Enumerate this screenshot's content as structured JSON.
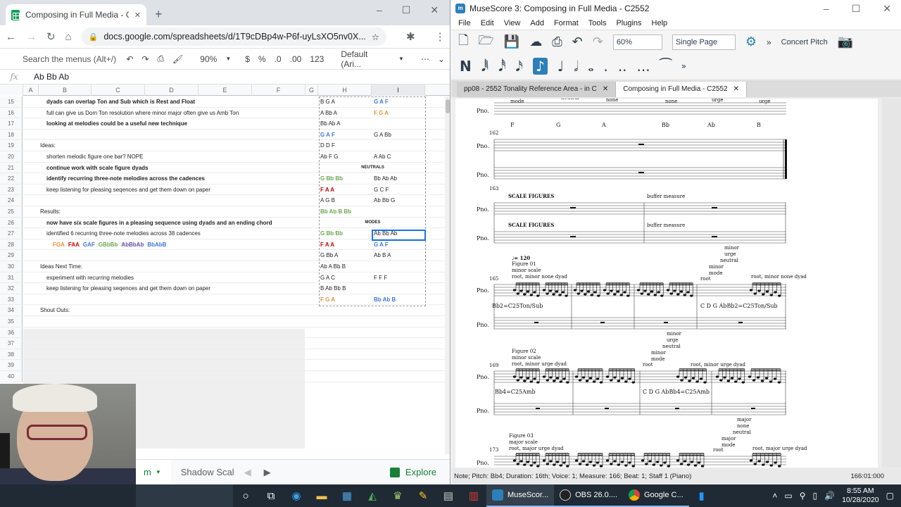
{
  "chrome": {
    "tab_title": "Composing in Full Media - Goog",
    "url": "docs.google.com/spreadsheets/d/1T9cDBp4w-P6f-uyLsXO5nv0X...",
    "new_tab": "+",
    "minimize": "–",
    "maximize": "☐",
    "close": "✕"
  },
  "sheets": {
    "search_menus": "Search the menus (Alt+/)",
    "zoom": "90%",
    "currency": "$",
    "percent": "%",
    "dec_less": ".0",
    "dec_more": ".00",
    "number_format": "123",
    "font": "Default (Ari...",
    "more": "⋯",
    "fx": "fx",
    "formula_value": "Ab Bb Ab",
    "columns": [
      "A",
      "B",
      "C",
      "D",
      "E",
      "F",
      "G",
      "H",
      "I"
    ],
    "rows": [
      {
        "n": "15",
        "b": "dyads can overlap Ton and Sub which is Rest and Float",
        "b_style": "bold indent1",
        "h": "B G A",
        "h_color": "#222",
        "i": "G A F",
        "i_color": "#3c78d8"
      },
      {
        "n": "16",
        "b": "full can give us Dom Ton resolution where minor major often give us Amb Ton",
        "b_style": "indent1",
        "h": "A Bb A",
        "h_color": "#222",
        "i": "F G A",
        "i_color": "#e69138"
      },
      {
        "n": "17",
        "b": "looking at melodies could be a useful new technique",
        "b_style": "bold indent1",
        "h": "Bb Ab A",
        "h_color": "#222",
        "i": "",
        "i_color": "#222"
      },
      {
        "n": "18",
        "b": "",
        "b_style": "",
        "h": "G A F",
        "h_color": "#3c78d8",
        "i": "G A Bb",
        "i_color": "#222"
      },
      {
        "n": "19",
        "b": "Ideas:",
        "b_style": "",
        "h": "D D F",
        "h_color": "#222",
        "i": "",
        "i_color": "#222"
      },
      {
        "n": "20",
        "b": "shorten melodic figure one bar? NOPE",
        "b_style": "indent1",
        "h": "Ab F G",
        "h_color": "#222",
        "i": "A Ab C",
        "i_color": "#222"
      },
      {
        "n": "21",
        "b": "continue work with scale figure dyads",
        "b_style": "bold indent1",
        "hi": "NEUTRALS"
      },
      {
        "n": "22",
        "b": "identify recurring three-note melodies across the cadences",
        "b_style": "bold indent1",
        "h": "G Bb Bb",
        "h_color": "#6aa84f",
        "i": "Bb Ab Ab",
        "i_color": "#222"
      },
      {
        "n": "23",
        "b": "keep listening for pleasing seqences and get them down on paper",
        "b_style": "indent1",
        "h": "F A A",
        "h_color": "#cc0000",
        "i": "G C F",
        "i_color": "#222"
      },
      {
        "n": "24",
        "b": "",
        "b_style": "",
        "h": "A G B",
        "h_color": "#222",
        "i": "Ab Bb G",
        "i_color": "#222"
      },
      {
        "n": "25",
        "b": "Results:",
        "b_style": "",
        "h": "Bb Ab B Bb",
        "h_color": "#6aa84f",
        "i": "",
        "i_color": "#222"
      },
      {
        "n": "26",
        "b": "now have six scale figures in a pleasing sequence using dyads and an ending chord",
        "b_style": "bold indent1",
        "hi": "MODES"
      },
      {
        "n": "27",
        "b": "identified 6 recurring three-note melodies across 38 cadences",
        "b_style": "indent1",
        "h": "G Bb Bb",
        "h_color": "#6aa84f",
        "i": "Ab Bb Ab",
        "i_color": "#222"
      },
      {
        "n": "28",
        "b": "",
        "b_style": "",
        "h": "F A A",
        "h_color": "#cc0000",
        "i": "G A F",
        "i_color": "#3c78d8",
        "melodies": true
      },
      {
        "n": "29",
        "b": "",
        "b_style": "",
        "h": "G Bb A",
        "h_color": "#222",
        "i": "Ab B A",
        "i_color": "#222"
      },
      {
        "n": "30",
        "b": "Ideas Next Time:",
        "b_style": "",
        "h": "Ab A Bb B",
        "h_color": "#222",
        "i": "",
        "i_color": "#222"
      },
      {
        "n": "31",
        "b": "experiment with recurring melodies",
        "b_style": "indent1",
        "h": "G A C",
        "h_color": "#222",
        "i": "F F F",
        "i_color": "#222"
      },
      {
        "n": "32",
        "b": "keep listening for pleasing seqences and get them down on paper",
        "b_style": "indent1",
        "h": "B Ab Bb B",
        "h_color": "#222",
        "i": "",
        "i_color": "#222"
      },
      {
        "n": "33",
        "b": "",
        "b_style": "",
        "h": "F G A",
        "h_color": "#e69138",
        "i": "Bb Ab B",
        "i_color": "#3c78d8"
      },
      {
        "n": "34",
        "b": "Shout Outs:",
        "b_style": "",
        "h": "",
        "h_color": "#222",
        "i": "",
        "i_color": "#222"
      },
      {
        "n": "35",
        "b": ""
      },
      {
        "n": "36",
        "b": ""
      },
      {
        "n": "37",
        "b": ""
      },
      {
        "n": "38",
        "b": ""
      },
      {
        "n": "39",
        "b": ""
      },
      {
        "n": "40",
        "b": ""
      }
    ],
    "melodies_row": [
      {
        "t": "FGA",
        "c": "#e69138"
      },
      {
        "t": "FAA",
        "c": "#cc0000"
      },
      {
        "t": "GAF",
        "c": "#3c78d8"
      },
      {
        "t": "GBbBb",
        "c": "#6aa84f"
      },
      {
        "t": "AbBbAb",
        "c": "#674ea7"
      },
      {
        "t": "BbAbB",
        "c": "#3c78d8"
      }
    ],
    "sheet_tab_partial": "m",
    "sheet_tab_shadow": "Shadow Scal",
    "explore": "Explore"
  },
  "musescore": {
    "title": "MuseScore 3: Composing in Full Media - C2552",
    "menu": [
      "File",
      "Edit",
      "View",
      "Add",
      "Format",
      "Tools",
      "Plugins",
      "Help"
    ],
    "zoom": "60%",
    "view_mode": "Single Page",
    "concert_pitch": "Concert Pitch",
    "tabs": [
      {
        "label": "pp08 - 2552 Tonality Reference Area - in C",
        "active": false
      },
      {
        "label": "Composing in Full Media - C2552",
        "active": true
      }
    ],
    "status_left": "Note; Pitch: Bb4; Duration: 16th; Voice: 1;   Measure: 166; Beat: 1; Staff 1 (Piano)",
    "status_right": "166:01:000",
    "score": {
      "pno": "Pno.",
      "row1_labels": [
        "mode",
        "neutral",
        "none",
        "none",
        "urge",
        "urge"
      ],
      "row1_notes": [
        "F",
        "G",
        "A",
        "Bb",
        "Ab",
        "B"
      ],
      "m162": "162",
      "m163": "163",
      "scale_figures": "SCALE FIGURES",
      "buffer_measure": "buffer measure",
      "m165": "165",
      "tempo": "♩= 120",
      "fig01": "Figure 01",
      "minor_scale": "minor scale",
      "root_minor_none": "root, minor none dyad",
      "stack_165": [
        "minor",
        "urge",
        "neutral",
        "minor",
        "mode",
        "root"
      ],
      "root_minor_none_r": "root, minor none dyad",
      "chord_165a": "Bb2=C25Ton/Sub",
      "chord_165b": "C  D  G  AbBb2=C25Ton/Sub",
      "stack_165_low": [
        "minor",
        "urge",
        "neutral",
        "minor",
        "mode",
        "root"
      ],
      "m169": "169",
      "fig02": "Figure 02",
      "root_minor_urge": "root, minor urge dyad",
      "root": "root",
      "root_minor_urge_r": "root, minor urge dyad",
      "chord_169a": "Bb4=C25Amb",
      "chord_169b": "C  D  G  AbBb4=C25Amb",
      "stack_169_low": [
        "major",
        "none",
        "neutral",
        "major",
        "mode",
        "root"
      ],
      "m173": "173",
      "fig03": "Figure 03",
      "major_scale": "major scale",
      "root_major_urge": "root, major urge dyad",
      "root_major_urge_r": "root, major urge dyad"
    }
  },
  "taskbar": {
    "apps": [
      "MuseScor...",
      "OBS 26.0....",
      "Google C..."
    ],
    "time": "8:55 AM",
    "date": "10/28/2020"
  }
}
